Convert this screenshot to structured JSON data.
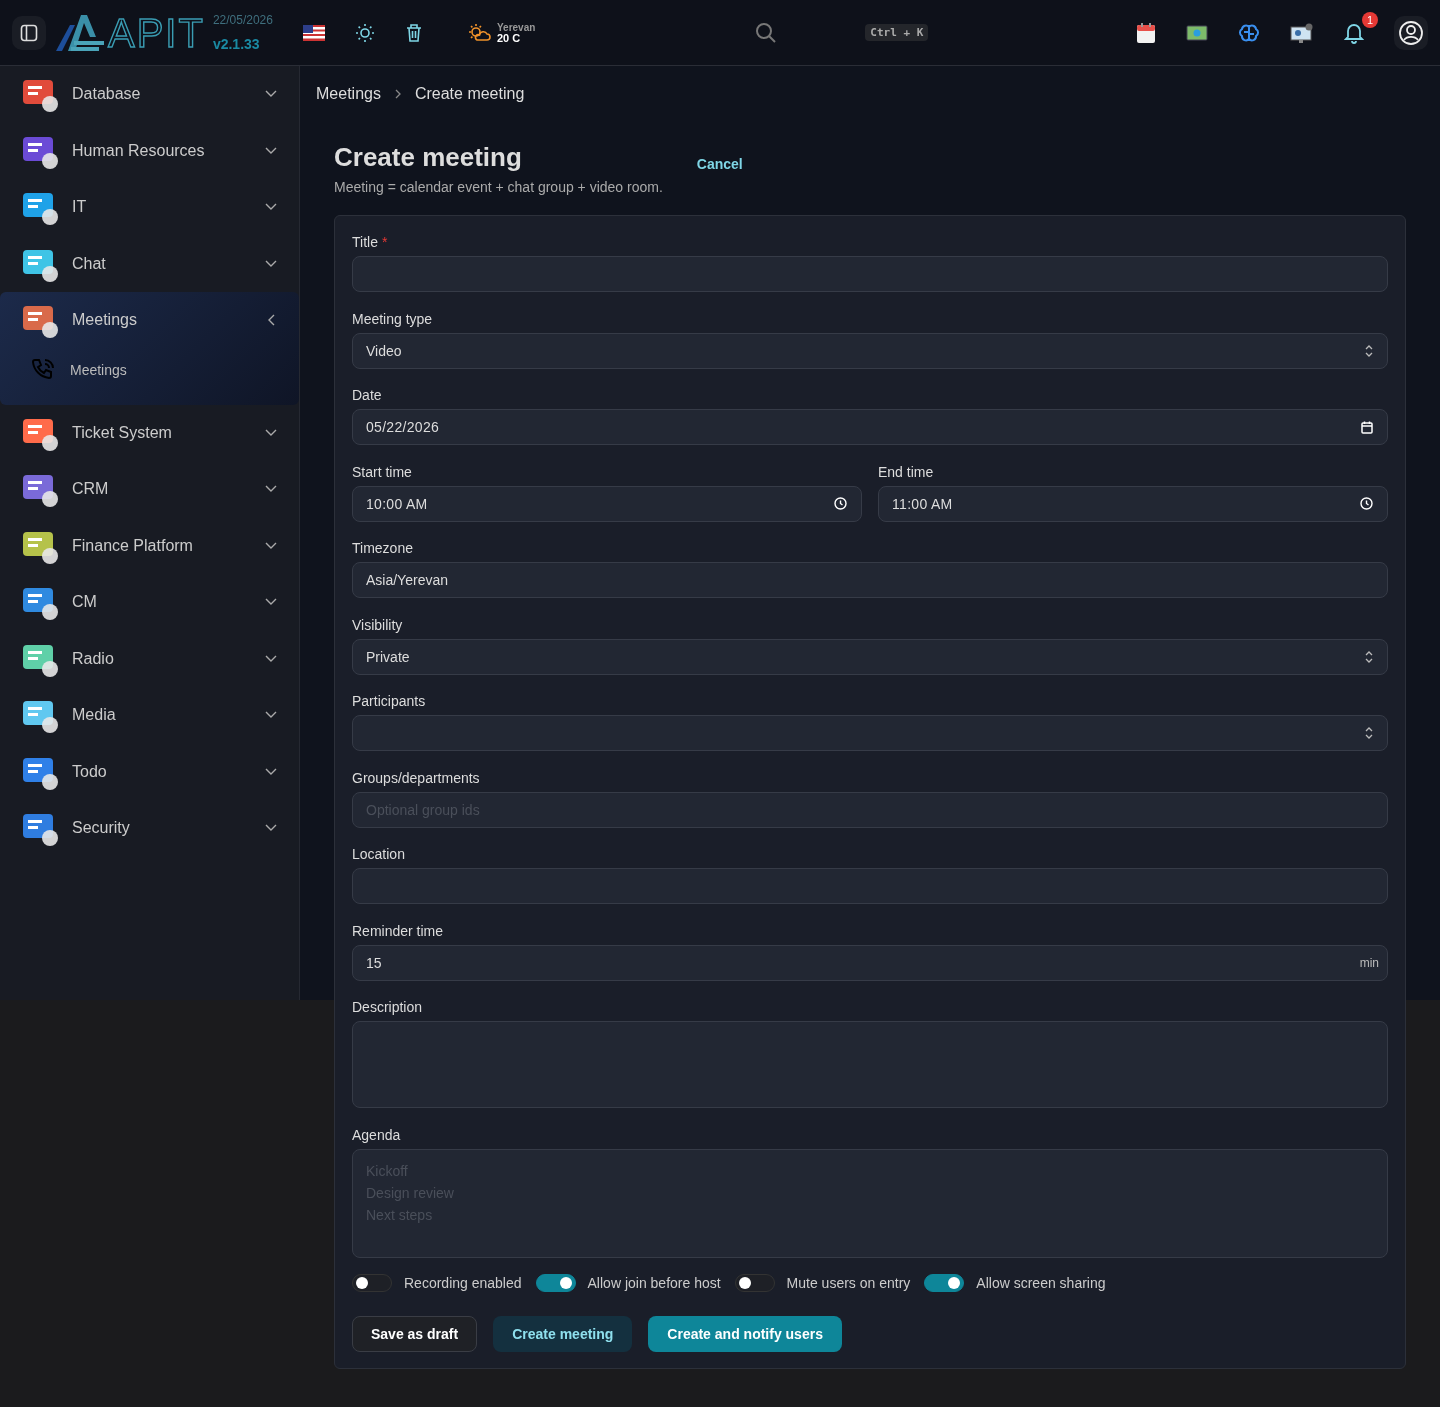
{
  "topbar": {
    "logo": "APIT",
    "date": "22/05/2026",
    "version": "v2.1.33",
    "weather": {
      "city": "Yerevan",
      "temp": "20 C"
    },
    "shortcut": "Ctrl + K",
    "notifications": "1"
  },
  "sidebar": {
    "items": [
      {
        "label": "Database",
        "expanded": false
      },
      {
        "label": "Human Resources",
        "expanded": false
      },
      {
        "label": "IT",
        "expanded": false
      },
      {
        "label": "Chat",
        "expanded": false
      },
      {
        "label": "Meetings",
        "expanded": true,
        "children": [
          {
            "label": "Meetings"
          }
        ]
      },
      {
        "label": "Ticket System",
        "expanded": false
      },
      {
        "label": "CRM",
        "expanded": false
      },
      {
        "label": "Finance Platform",
        "expanded": false
      },
      {
        "label": "CM",
        "expanded": false
      },
      {
        "label": "Radio",
        "expanded": false
      },
      {
        "label": "Media",
        "expanded": false
      },
      {
        "label": "Todo",
        "expanded": false
      },
      {
        "label": "Security",
        "expanded": false
      }
    ]
  },
  "breadcrumb": [
    "Meetings",
    "Create meeting"
  ],
  "page": {
    "title": "Create meeting",
    "subtitle": "Meeting = calendar event + chat group + video room.",
    "cancel": "Cancel"
  },
  "form": {
    "rows": [
      [
        {
          "label": "Title",
          "required_mark": "*",
          "kind": "text"
        }
      ],
      [
        {
          "label": "Meeting type",
          "kind": "select",
          "value": "Video"
        }
      ],
      [
        {
          "label": "Date",
          "kind": "date",
          "value": "05/22/2026"
        }
      ],
      [
        {
          "label": "Start time",
          "kind": "time",
          "value": "10:00 AM"
        },
        {
          "label": "End time",
          "kind": "time",
          "value": "11:00 AM"
        }
      ],
      [
        {
          "label": "Timezone",
          "kind": "text",
          "value": "Asia/Yerevan"
        }
      ],
      [
        {
          "label": "Visibility",
          "kind": "select",
          "value": "Private"
        }
      ],
      [
        {
          "label": "Participants",
          "kind": "select"
        }
      ],
      [
        {
          "label": "Groups/departments",
          "kind": "text",
          "placeholder": "Optional group ids"
        }
      ],
      [
        {
          "label": "Location",
          "kind": "text"
        }
      ],
      [
        {
          "label": "Reminder time",
          "kind": "suffix",
          "value": "15",
          "suffix": "min"
        }
      ],
      [
        {
          "label": "Description",
          "kind": "textarea"
        }
      ],
      [
        {
          "label": "Agenda",
          "kind": "textarea",
          "placeholder": "Kickoff\nDesign review\nNext steps"
        }
      ]
    ],
    "toggles": [
      {
        "label": "Recording enabled",
        "on": false
      },
      {
        "label": "Allow join before host",
        "on": true
      },
      {
        "label": "Mute users on entry",
        "on": false
      },
      {
        "label": "Allow screen sharing",
        "on": true
      }
    ],
    "buttons": [
      {
        "label": "Save as draft",
        "kind": "outline"
      },
      {
        "label": "Create meeting",
        "kind": "soft"
      },
      {
        "label": "Create and notify users",
        "kind": "primary"
      }
    ]
  }
}
